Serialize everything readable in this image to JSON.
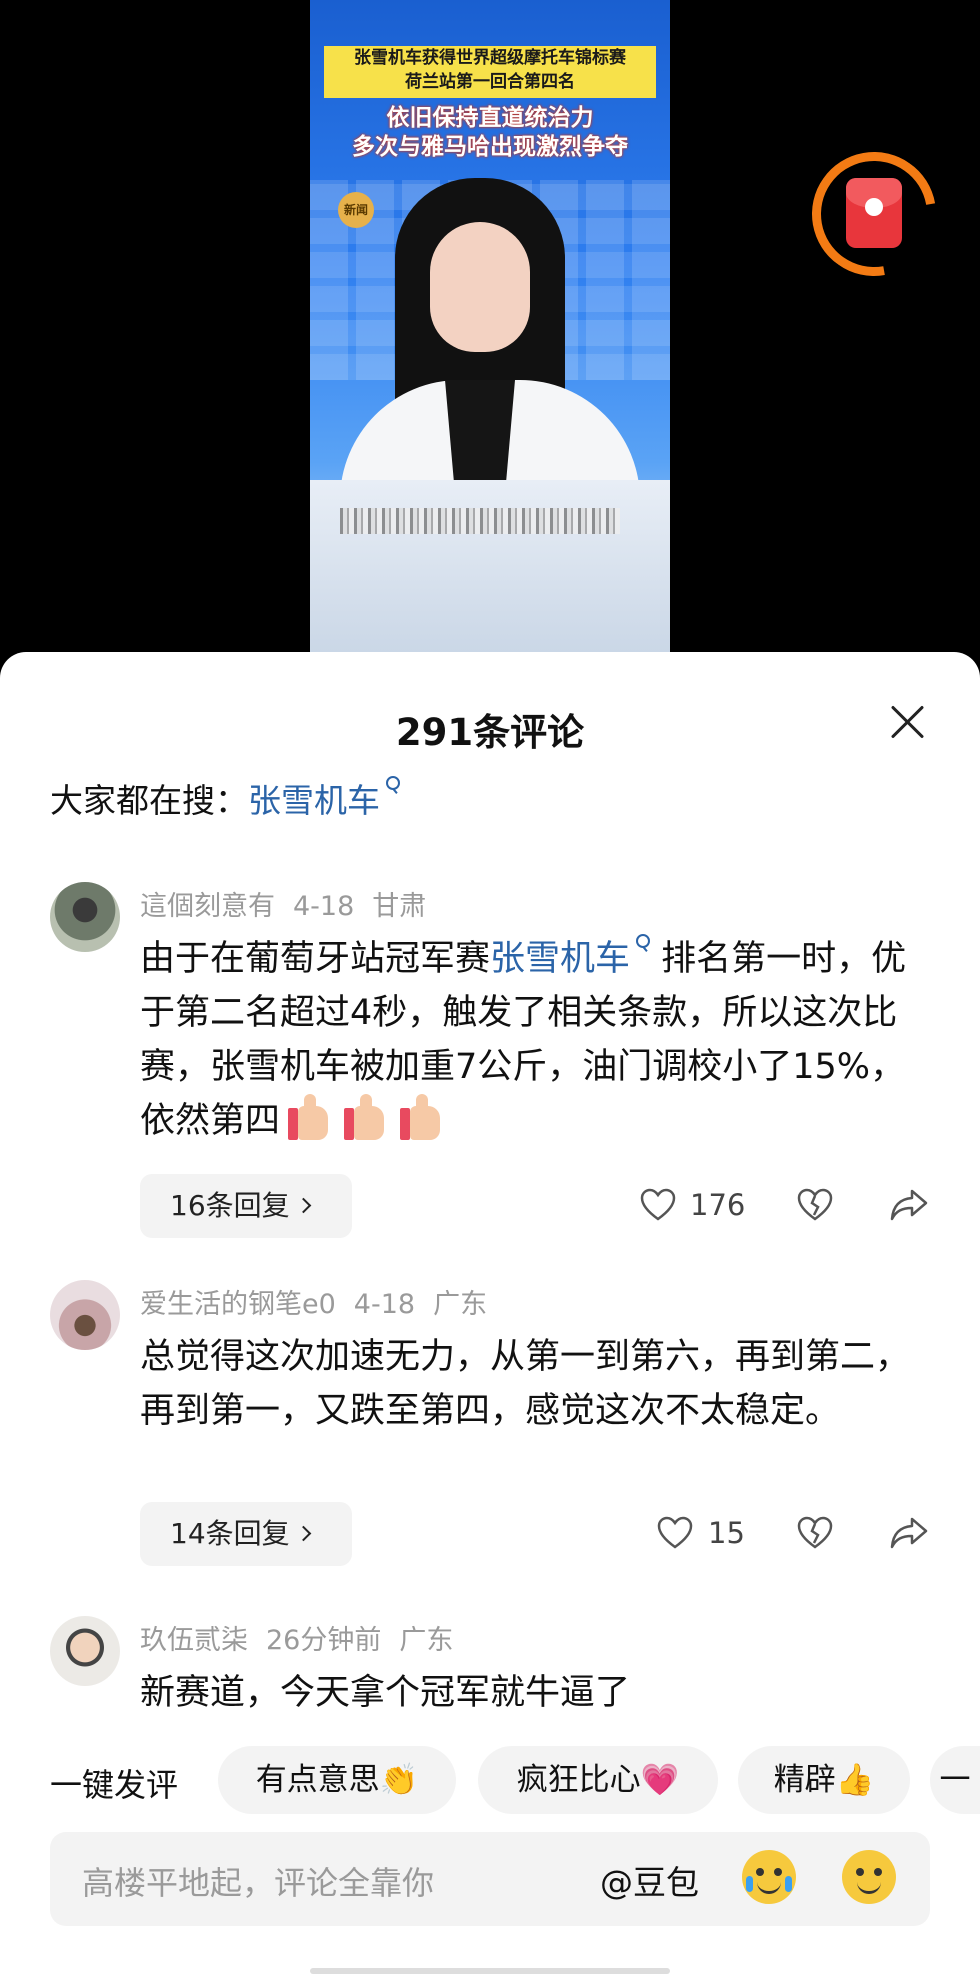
{
  "video": {
    "headline_line1": "张雪机车获得世界超级摩托车锦标赛",
    "headline_line2": "荷兰站第一回合第四名",
    "subline_line1": "依旧保持直道统治力",
    "subline_line2": "多次与雅马哈出现激烈争夺",
    "badge": "新闻",
    "red_packet_icon": "red-envelope-icon"
  },
  "sheet": {
    "title": "291条评论",
    "search_prefix": "大家都在搜：",
    "search_term": "张雪机车"
  },
  "comments": [
    {
      "user": "這個刻意有",
      "date": "4-18",
      "location": "甘肃",
      "text_before_link": "由于在葡萄牙站冠军赛",
      "link": "张雪机车",
      "text_after_link": " 排名第一时，优于第二名超过4秒，触发了相关条款，所以这次比赛，张雪机车被加重7公斤，油门调校小了15%，依然第四",
      "emoji": [
        "thumbs-up",
        "thumbs-up",
        "thumbs-up"
      ],
      "replies": "16条回复",
      "likes": "176"
    },
    {
      "user": "爱生活的钢笔e0",
      "date": "4-18",
      "location": "广东",
      "text": "总觉得这次加速无力，从第一到第六，再到第二，再到第一，又跌至第四，感觉这次不太稳定。",
      "replies": "14条回复",
      "likes": "15"
    },
    {
      "user": "玖伍贰柒",
      "date": "26分钟前",
      "location": "广东",
      "text": "新赛道，今天拿个冠军就牛逼了"
    }
  ],
  "quick_reply": {
    "label": "一键发评",
    "chips": [
      "有点意思👏",
      "疯狂比心💗",
      "精辟👍",
      "一"
    ]
  },
  "input": {
    "placeholder": "高楼平地起，评论全靠你",
    "mention": "@豆包"
  }
}
